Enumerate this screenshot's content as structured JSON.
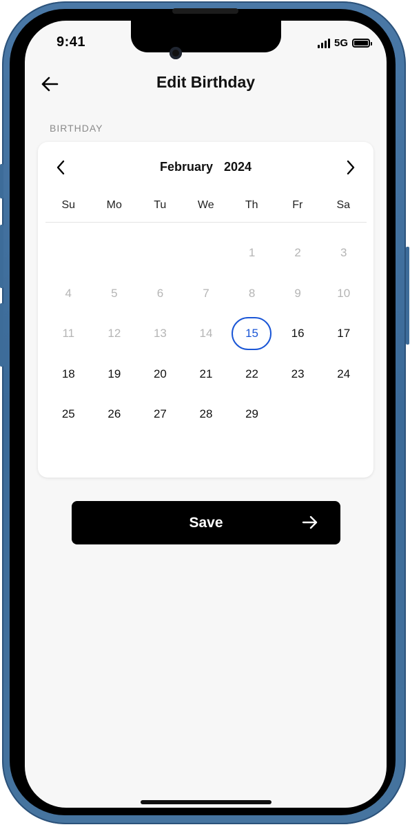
{
  "status_bar": {
    "time": "9:41",
    "network": "5G"
  },
  "header": {
    "title": "Edit Birthday",
    "back_icon": "arrow-left-icon"
  },
  "section": {
    "label": "BIRTHDAY"
  },
  "calendar": {
    "month": "February",
    "year": "2024",
    "prev_icon": "chevron-left-icon",
    "next_icon": "chevron-right-icon",
    "weekdays": [
      "Su",
      "Mo",
      "Tu",
      "We",
      "Th",
      "Fr",
      "Sa"
    ],
    "selected_day": "15",
    "selected_color": "#1a56d6",
    "days": [
      "",
      "",
      "",
      "",
      "1",
      "2",
      "3",
      "4",
      "5",
      "6",
      "7",
      "8",
      "9",
      "10",
      "11",
      "12",
      "13",
      "14",
      "15",
      "16",
      "17",
      "18",
      "19",
      "20",
      "21",
      "22",
      "23",
      "24",
      "25",
      "26",
      "27",
      "28",
      "29",
      "",
      ""
    ],
    "disabled_days": [
      "1",
      "2",
      "3",
      "4",
      "5",
      "6",
      "7",
      "8",
      "9",
      "10",
      "11",
      "12",
      "13",
      "14"
    ]
  },
  "actions": {
    "save_label": "Save",
    "save_icon": "arrow-right-icon"
  }
}
